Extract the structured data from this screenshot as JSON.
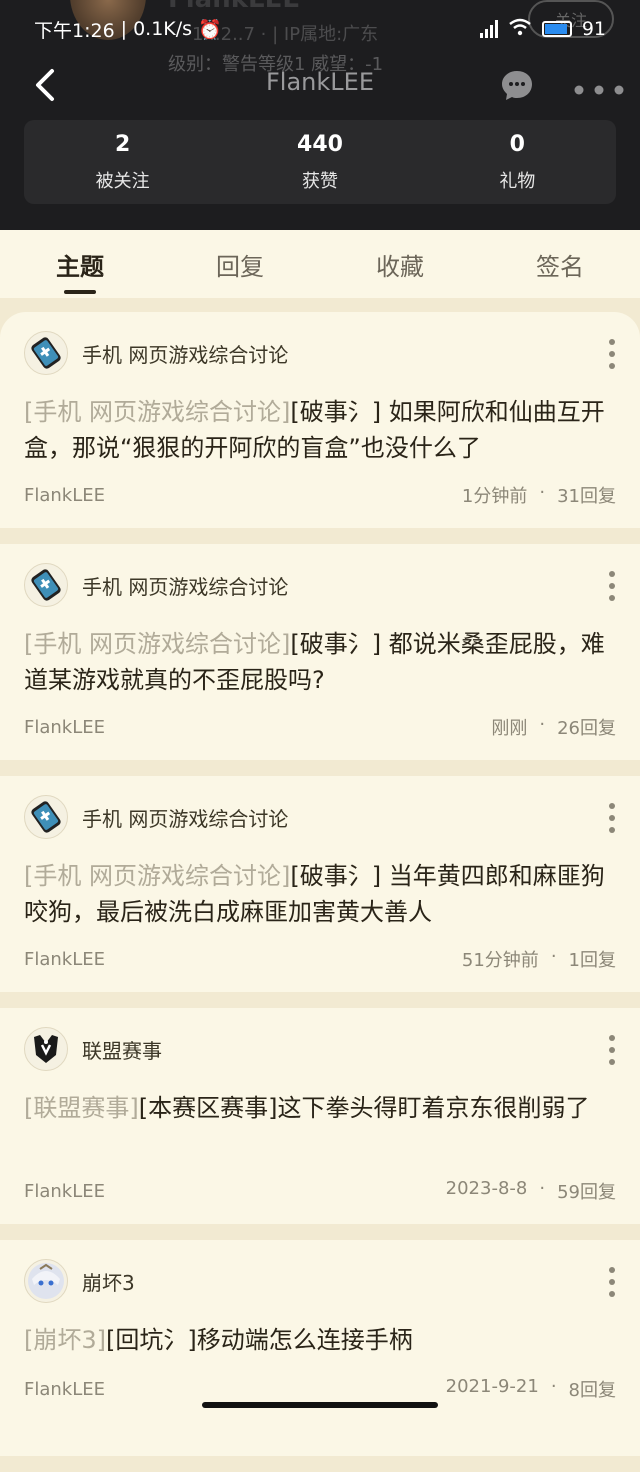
{
  "status_bar": {
    "time": "下午1:26",
    "speed": "0.1K/s",
    "battery": "91"
  },
  "ghost_profile": {
    "name": "FlankLEE",
    "meta_line1": "1...2..7 · | IP属地:广东",
    "meta_line2": "级别：警告等级1   威望：-1",
    "follow_label": "关注"
  },
  "nav": {
    "title": "FlankLEE"
  },
  "stats": [
    {
      "value": "2",
      "label": "被关注"
    },
    {
      "value": "440",
      "label": "获赞"
    },
    {
      "value": "0",
      "label": "礼物"
    }
  ],
  "tabs": [
    {
      "label": "主题",
      "active": true
    },
    {
      "label": "回复",
      "active": false
    },
    {
      "label": "收藏",
      "active": false
    },
    {
      "label": "签名",
      "active": false
    }
  ],
  "posts": [
    {
      "forum": "手机 网页游戏综合讨论",
      "forum_icon": "gamepad-icon",
      "title_forum": "[手机 网页游戏综合讨论]",
      "title_text": "[破事氵] 如果阿欣和仙曲互开盒，那说“狠狠的开阿欣的盲盒”也没什么了",
      "author": "FlankLEE",
      "time": "1分钟前",
      "replies": "31回复"
    },
    {
      "forum": "手机 网页游戏综合讨论",
      "forum_icon": "gamepad-icon",
      "title_forum": "[手机 网页游戏综合讨论]",
      "title_text": "[破事氵] 都说米桑歪屁股，难道某游戏就真的不歪屁股吗?",
      "author": "FlankLEE",
      "time": "刚刚",
      "replies": "26回复"
    },
    {
      "forum": "手机 网页游戏综合讨论",
      "forum_icon": "gamepad-icon",
      "title_forum": "[手机 网页游戏综合讨论]",
      "title_text": "[破事氵] 当年黄四郎和麻匪狗咬狗，最后被洗白成麻匪加害黄大善人",
      "author": "FlankLEE",
      "time": "51分钟前",
      "replies": "1回复"
    },
    {
      "forum": "联盟赛事",
      "forum_icon": "lol-emblem-icon",
      "title_forum": "[联盟赛事]",
      "title_text": "[本赛区赛事]这下拳头得盯着京东很削弱了",
      "author": "FlankLEE",
      "time": "2023-8-8",
      "replies": "59回复"
    },
    {
      "forum": "崩坏3",
      "forum_icon": "anime-avatar-icon",
      "title_forum": "[崩坏3]",
      "title_text": "[回坑氵]移动端怎么连接手柄",
      "author": "FlankLEE",
      "time": "2021-9-21",
      "replies": "8回复"
    }
  ]
}
